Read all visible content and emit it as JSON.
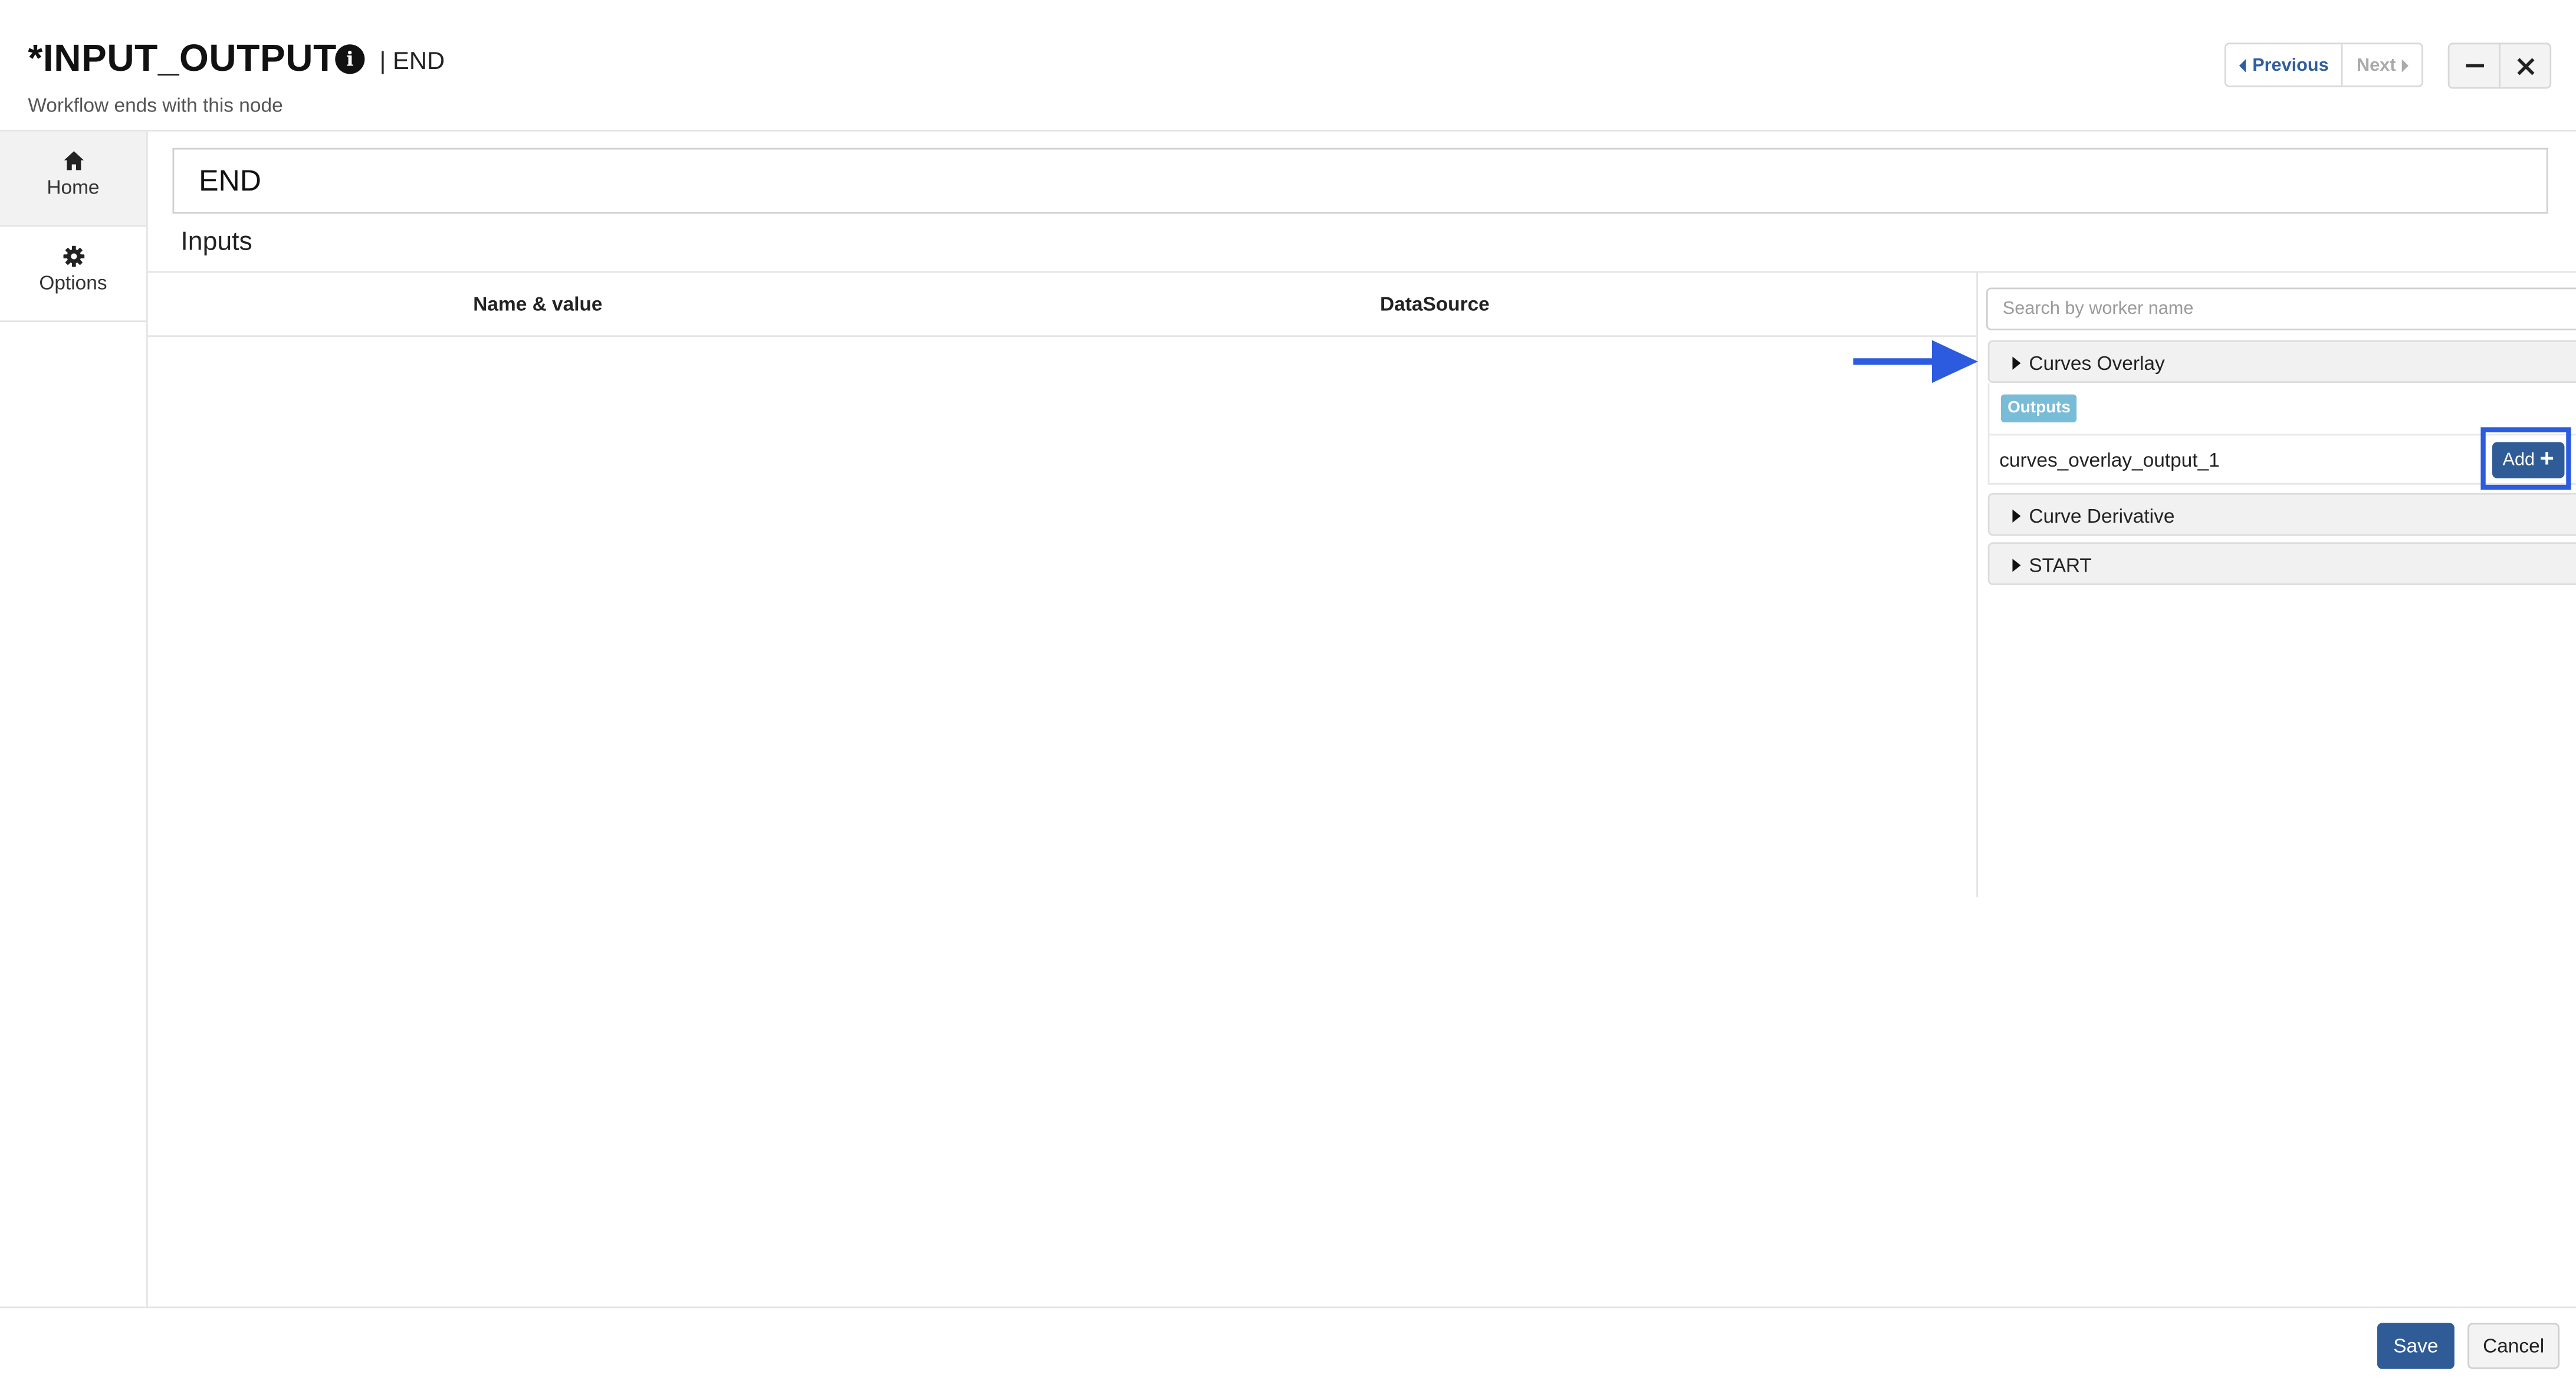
{
  "header": {
    "title": "*INPUT_OUTPUT",
    "title_suffix": "| END",
    "subtitle": "Workflow ends with this node",
    "previous_label": "Previous",
    "next_label": "Next",
    "info_icon": "info-circle-icon",
    "close_icon": "close-icon",
    "minimize_icon": "minimize-icon"
  },
  "sidebar": {
    "items": [
      {
        "label": "Home",
        "icon": "home-icon",
        "active": true
      },
      {
        "label": "Options",
        "icon": "gear-icon",
        "active": false
      }
    ]
  },
  "main": {
    "node_name": "END",
    "section_label": "Inputs",
    "columns": [
      "Name & value",
      "DataSource"
    ]
  },
  "worker_panel": {
    "search_placeholder": "Search by worker name",
    "workers": [
      {
        "name": "Curves Overlay",
        "expanded": true,
        "outputs_label": "Outputs",
        "outputs": [
          "curves_overlay_output_1"
        ],
        "add_label": "Add"
      },
      {
        "name": "Curve Derivative",
        "expanded": false
      },
      {
        "name": "START",
        "expanded": false
      }
    ]
  },
  "annotation": {
    "highlight_color": "#2c5be0"
  },
  "footer": {
    "save_label": "Save",
    "cancel_label": "Cancel"
  },
  "colors": {
    "primary_button": "#2f5c96",
    "badge": "#78bcd8",
    "link": "#2f5e9e"
  }
}
